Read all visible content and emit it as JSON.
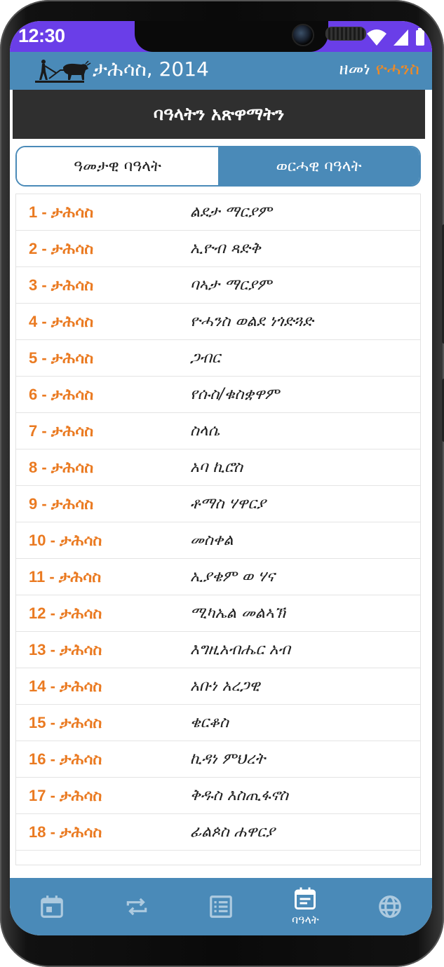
{
  "status_bar": {
    "time": "12:30"
  },
  "app_bar": {
    "date": "ታሕሳስ, 2014",
    "era_prefix": "ዘመነ",
    "era_name": "ዮሓንስ"
  },
  "page_title": "ባዓላትን አጽዋማትን",
  "tabs": [
    {
      "label": "ዓመታዊ ባዓላት",
      "active": false
    },
    {
      "label": "ወርሓዊ ባዓላት",
      "active": true
    }
  ],
  "feasts": [
    {
      "date": "1 - ታሕሳስ",
      "name": "ልደታ ማርያም"
    },
    {
      "date": "2 - ታሕሳስ",
      "name": "ኢዮብ ጻድቅ"
    },
    {
      "date": "3 - ታሕሳስ",
      "name": "ባኣታ ማርያም"
    },
    {
      "date": "4 - ታሕሳስ",
      "name": "ዮሓንስ ወልደ ነጎድጓድ"
    },
    {
      "date": "5 - ታሕሳስ",
      "name": "ጋብር"
    },
    {
      "date": "6 - ታሕሳስ",
      "name": "የሱስ/ቁስቋዋም"
    },
    {
      "date": "7 - ታሕሳስ",
      "name": "ስላሴ"
    },
    {
      "date": "8 - ታሕሳስ",
      "name": "አባ ኪሮስ"
    },
    {
      "date": "9 - ታሕሳስ",
      "name": "ቶማስ ሃዋርያ"
    },
    {
      "date": "10 - ታሕሳስ",
      "name": "መስቀል"
    },
    {
      "date": "11 - ታሕሳስ",
      "name": "ኢያቄም ወ ሃና"
    },
    {
      "date": "12 - ታሕሳስ",
      "name": "ሚካኤል መልኣኽ"
    },
    {
      "date": "13 - ታሕሳስ",
      "name": "እግዚአብሔር አብ"
    },
    {
      "date": "14 - ታሕሳስ",
      "name": "አቡነ አረጋዊ"
    },
    {
      "date": "15 - ታሕሳስ",
      "name": "ቄርቆስ"
    },
    {
      "date": "16 - ታሕሳስ",
      "name": "ኪዳነ ምህረት"
    },
    {
      "date": "17 - ታሕሳስ",
      "name": "ቅዱስ እስጢፋኖስ"
    },
    {
      "date": "18 - ታሕሳስ",
      "name": "ፊልጶስ ሐዋርያ"
    }
  ],
  "bottom_nav": [
    {
      "icon": "calendar-icon",
      "label": "",
      "active": false
    },
    {
      "icon": "convert-icon",
      "label": "",
      "active": false
    },
    {
      "icon": "list-icon",
      "label": "",
      "active": false
    },
    {
      "icon": "event-note-icon",
      "label": "ባዓላት",
      "active": true
    },
    {
      "icon": "globe-icon",
      "label": "",
      "active": false
    }
  ],
  "colors": {
    "primary": "#4a8ab8",
    "accent": "#f08a24",
    "status_bar": "#6a3ee8",
    "title_bar": "#2f2f2f"
  }
}
